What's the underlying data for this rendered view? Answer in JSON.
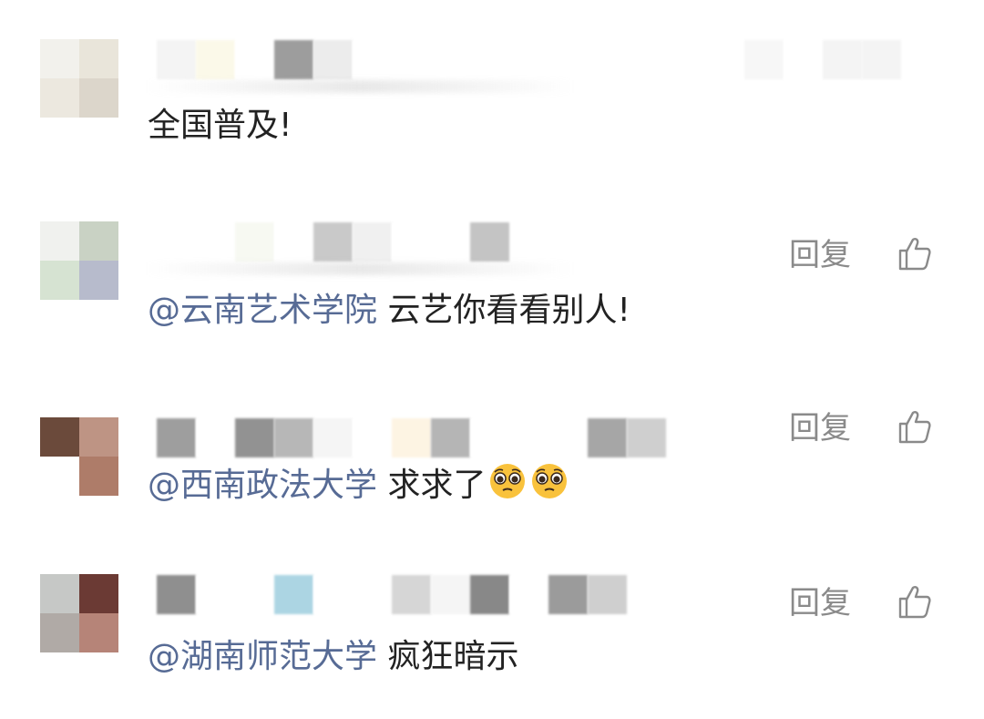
{
  "comments": [
    {
      "mention": "",
      "text": "全国普及!",
      "has_reply": false,
      "avatar_colors": [
        "#f2f1ec",
        "#e9e5da",
        "#ece8df",
        "#dcd6cb"
      ],
      "name_blocks": [
        "#f4f4f4",
        "#fbf9e9",
        "#ffffff",
        "#9d9d9d",
        "#ececec",
        "#ffffff",
        "#ffffff",
        "#ffffff",
        "#ffffff",
        "#ffffff",
        "#ffffff",
        "#ffffff",
        "#ffffff",
        "#ffffff",
        "#ffffff",
        "#f7f7f7",
        "#ffffff",
        "#f4f4f4",
        "#f4f4f4"
      ]
    },
    {
      "mention": "@云南艺术学院",
      "text": "云艺你看看别人!",
      "has_reply": true,
      "avatar_colors": [
        "#f0f1ee",
        "#c9d2c4",
        "#d6e3d2",
        "#b7bbcc"
      ],
      "name_blocks": [
        "#ffffff",
        "#ffffff",
        "#f7f9f2",
        "#ffffff",
        "#c9c9c9",
        "#f0f0f0",
        "#ffffff",
        "#ffffff",
        "#c4c4c4"
      ]
    },
    {
      "mention": "@西南政法大学",
      "text": "求求了",
      "emoji_count": 2,
      "has_reply": true,
      "avatar_colors": [
        "#6b4a3b",
        "#be9484",
        "#ffffff",
        "#ae7c69"
      ],
      "name_blocks": [
        "#9e9e9e",
        "#ffffff",
        "#929292",
        "#b7b7b7",
        "#f5f5f5",
        "#ffffff",
        "#fdf4e3",
        "#b5b5b5",
        "#ffffff",
        "#ffffff",
        "#ffffff",
        "#a6a6a6",
        "#cfcfcf"
      ]
    },
    {
      "mention": "@湖南师范大学",
      "text": "疯狂暗示",
      "has_reply": true,
      "avatar_colors": [
        "#c6c8c6",
        "#6b3a34",
        "#b0aaa6",
        "#b68478"
      ],
      "name_blocks": [
        "#8f8f8f",
        "#ffffff",
        "#ffffff",
        "#acd5e3",
        "#ffffff",
        "#ffffff",
        "#d6d6d6",
        "#f5f5f5",
        "#888888",
        "#ffffff",
        "#9b9b9b",
        "#cfcfcf"
      ]
    }
  ],
  "reply_label": "回复",
  "colors": {
    "mention": "#576b95",
    "text": "#222222",
    "reply": "#8a8a8a"
  },
  "icons": {
    "like": "thumbs-up-icon",
    "emoji": "pleading-face-emoji"
  }
}
